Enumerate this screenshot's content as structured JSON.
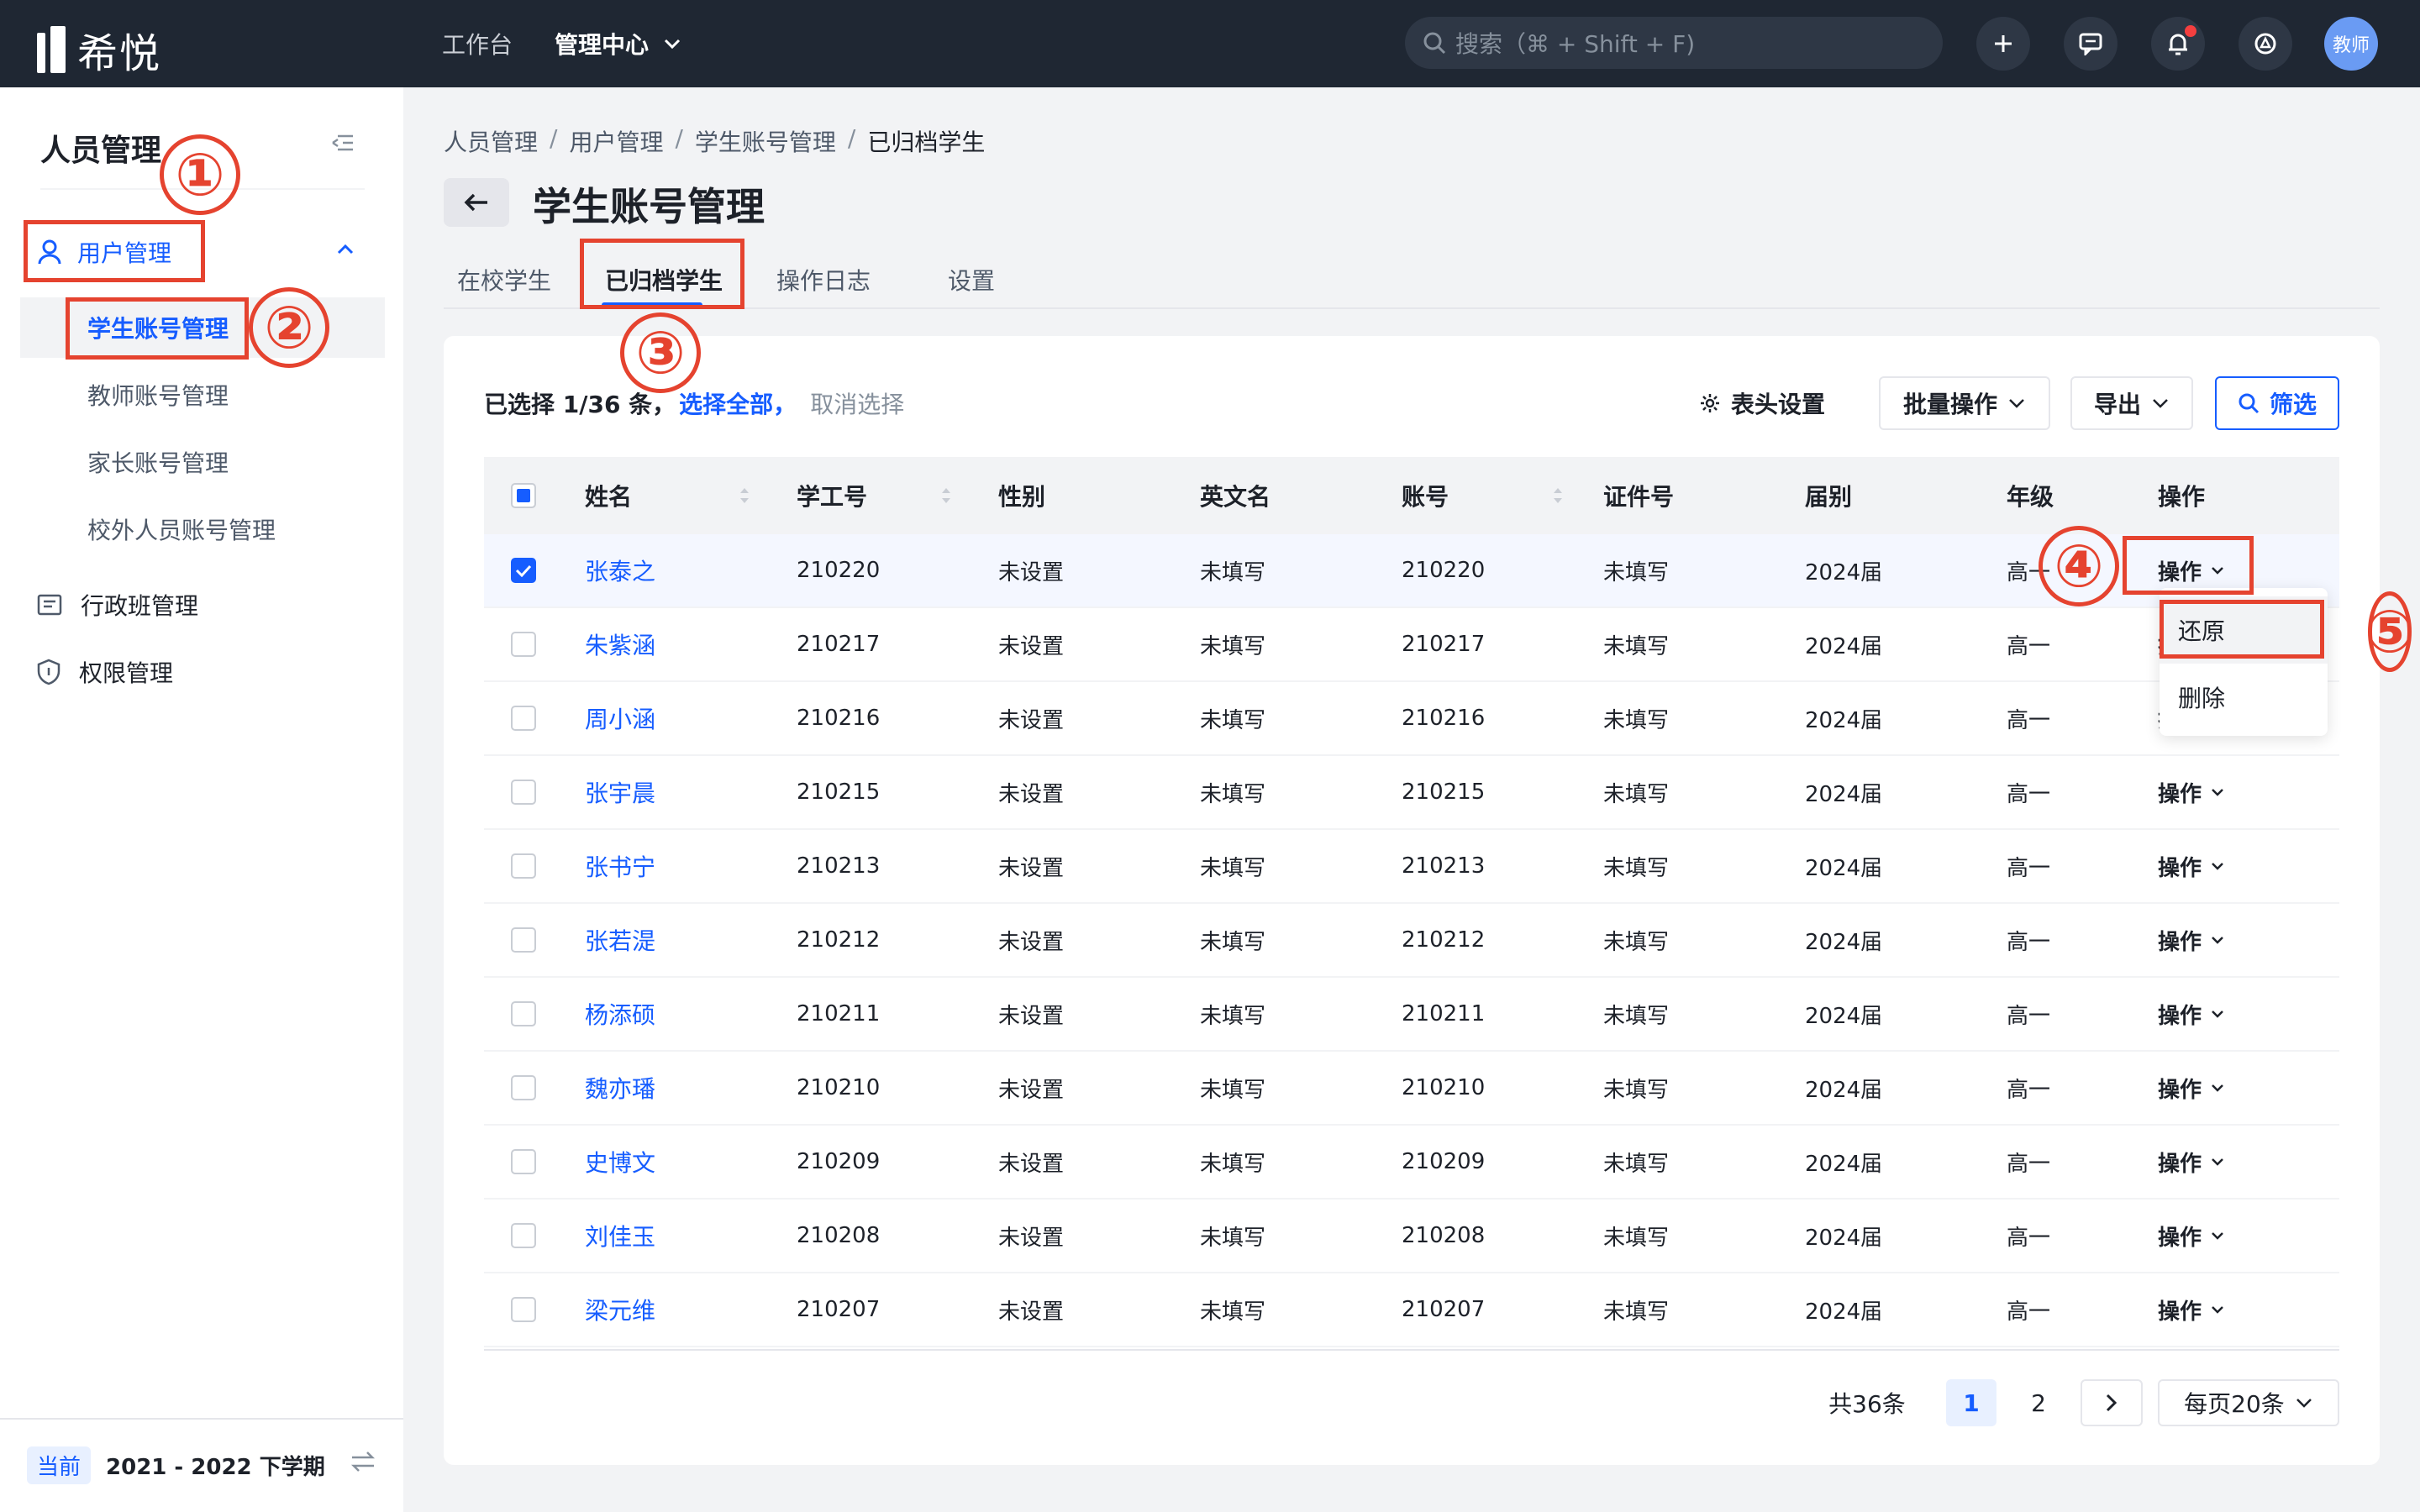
{
  "app": {
    "logo_text": "希悦",
    "nav": [
      {
        "label": "工作台"
      },
      {
        "label": "管理中心"
      }
    ],
    "search_placeholder": "搜索（⌘ + Shift + F)",
    "avatar_label": "教师"
  },
  "sidebar": {
    "title": "人员管理",
    "group_label": "用户管理",
    "sub_items": [
      {
        "label": "学生账号管理"
      },
      {
        "label": "教师账号管理"
      },
      {
        "label": "家长账号管理"
      },
      {
        "label": "校外人员账号管理"
      }
    ],
    "items": [
      {
        "label": "行政班管理"
      },
      {
        "label": "权限管理"
      }
    ],
    "term_badge": "当前",
    "term_text": "2021 - 2022 下学期"
  },
  "breadcrumb": [
    "人员管理",
    "用户管理",
    "学生账号管理",
    "已归档学生"
  ],
  "breadcrumb_sep": "/",
  "page_title": "学生账号管理",
  "tabs": [
    {
      "label": "在校学生"
    },
    {
      "label": "已归档学生"
    },
    {
      "label": "操作日志"
    },
    {
      "label": "设置"
    }
  ],
  "selection": {
    "text": "已选择 1/36 条，",
    "select_all": "选择全部，",
    "cancel": "取消选择"
  },
  "toolbar": {
    "header_settings": "表头设置",
    "batch": "批量操作",
    "export": "导出",
    "filter": "筛选"
  },
  "table": {
    "columns": [
      "姓名",
      "学工号",
      "性别",
      "英文名",
      "账号",
      "证件号",
      "届别",
      "年级",
      "操作"
    ],
    "rows": [
      {
        "name": "张泰之",
        "id": "210220",
        "gender": "未设置",
        "en": "未填写",
        "account": "210220",
        "cert": "未填写",
        "cohort": "2024届",
        "grade": "高一",
        "op": "操作",
        "checked": true
      },
      {
        "name": "朱紫涵",
        "id": "210217",
        "gender": "未设置",
        "en": "未填写",
        "account": "210217",
        "cert": "未填写",
        "cohort": "2024届",
        "grade": "高一",
        "op": "操作",
        "checked": false
      },
      {
        "name": "周小涵",
        "id": "210216",
        "gender": "未设置",
        "en": "未填写",
        "account": "210216",
        "cert": "未填写",
        "cohort": "2024届",
        "grade": "高一",
        "op": "操作",
        "checked": false
      },
      {
        "name": "张宇晨",
        "id": "210215",
        "gender": "未设置",
        "en": "未填写",
        "account": "210215",
        "cert": "未填写",
        "cohort": "2024届",
        "grade": "高一",
        "op": "操作",
        "checked": false
      },
      {
        "name": "张书宁",
        "id": "210213",
        "gender": "未设置",
        "en": "未填写",
        "account": "210213",
        "cert": "未填写",
        "cohort": "2024届",
        "grade": "高一",
        "op": "操作",
        "checked": false
      },
      {
        "name": "张若湜",
        "id": "210212",
        "gender": "未设置",
        "en": "未填写",
        "account": "210212",
        "cert": "未填写",
        "cohort": "2024届",
        "grade": "高一",
        "op": "操作",
        "checked": false
      },
      {
        "name": "杨添硕",
        "id": "210211",
        "gender": "未设置",
        "en": "未填写",
        "account": "210211",
        "cert": "未填写",
        "cohort": "2024届",
        "grade": "高一",
        "op": "操作",
        "checked": false
      },
      {
        "name": "魏亦璠",
        "id": "210210",
        "gender": "未设置",
        "en": "未填写",
        "account": "210210",
        "cert": "未填写",
        "cohort": "2024届",
        "grade": "高一",
        "op": "操作",
        "checked": false
      },
      {
        "name": "史博文",
        "id": "210209",
        "gender": "未设置",
        "en": "未填写",
        "account": "210209",
        "cert": "未填写",
        "cohort": "2024届",
        "grade": "高一",
        "op": "操作",
        "checked": false
      },
      {
        "name": "刘佳玉",
        "id": "210208",
        "gender": "未设置",
        "en": "未填写",
        "account": "210208",
        "cert": "未填写",
        "cohort": "2024届",
        "grade": "高一",
        "op": "操作",
        "checked": false
      },
      {
        "name": "梁元维",
        "id": "210207",
        "gender": "未设置",
        "en": "未填写",
        "account": "210207",
        "cert": "未填写",
        "cohort": "2024届",
        "grade": "高一",
        "op": "操作",
        "checked": false
      }
    ]
  },
  "dropdown": {
    "items": [
      {
        "label": "还原"
      },
      {
        "label": "删除"
      }
    ]
  },
  "pagination": {
    "total": "共36条",
    "pages": [
      "1",
      "2"
    ],
    "page_size": "每页20条"
  },
  "annotations": [
    "①",
    "②",
    "③",
    "④",
    "⑤"
  ],
  "colors": {
    "primary": "#165dff",
    "topbar": "#1f2733",
    "annotation": "#e5432f"
  }
}
